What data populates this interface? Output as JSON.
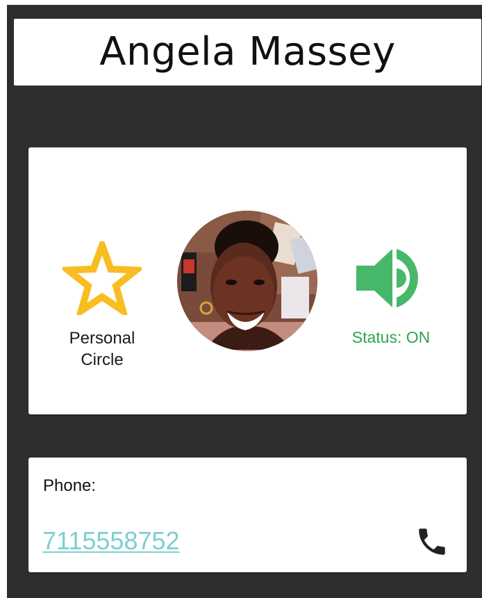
{
  "contact": {
    "name": "Angela Massey"
  },
  "profile": {
    "circle_icon": "star-icon",
    "circle_label": "Personal Circle",
    "avatar": "contact-photo",
    "status_icon": "speaker-on-icon",
    "status_label": "Status: ON"
  },
  "phone": {
    "label": "Phone:",
    "number": "7115558752",
    "call_icon": "phone-icon"
  },
  "colors": {
    "background": "#2e2e2e",
    "card": "#ffffff",
    "star": "#f8bd22",
    "status": "#2ea44f",
    "speaker": "#47b86a",
    "link": "#7ccfd0",
    "call_icon": "#222222"
  }
}
